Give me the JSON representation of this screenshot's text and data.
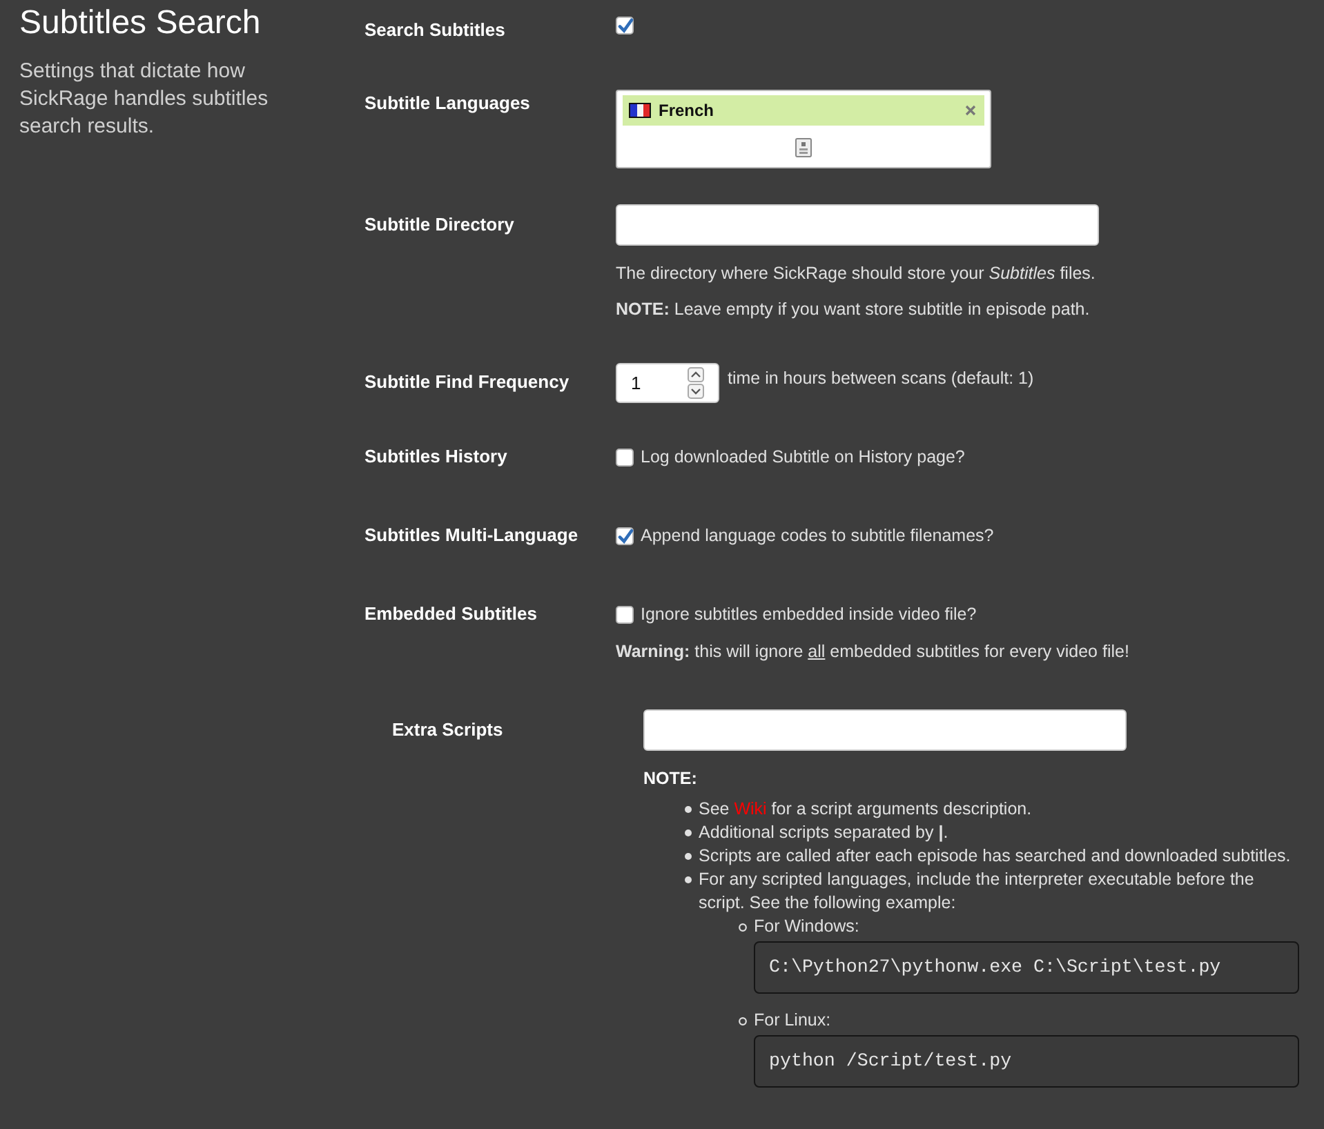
{
  "section": {
    "title": "Subtitles Search",
    "description": "Settings that dictate how SickRage handles subtitles search results."
  },
  "fields": [
    {
      "kind": "checkbox",
      "label": "Search Subtitles",
      "checked": true
    },
    {
      "kind": "tokens",
      "label": "Subtitle Languages",
      "tokens": [
        {
          "text": "French"
        }
      ]
    },
    {
      "kind": "text",
      "label": "Subtitle Directory",
      "help": [
        "The directory where SickRage should store your *Subtitles* files.",
        "**NOTE:** Leave empty if you want store subtitle in episode path."
      ]
    },
    {
      "kind": "number",
      "label": "Subtitle Find Frequency",
      "value": "1",
      "hint": "time in hours between scans (default: 1)"
    },
    {
      "kind": "checkbox",
      "label": "Subtitles History",
      "checked": false,
      "text": "Log downloaded Subtitle on History page?"
    },
    {
      "kind": "checkbox",
      "label": "Subtitles Multi-Language",
      "checked": true,
      "text": "Append language codes to subtitle filenames?"
    },
    {
      "kind": "checkbox",
      "label": "Embedded Subtitles",
      "checked": false,
      "text": "Ignore subtitles embedded inside video file?",
      "warning": [
        {
          "kind": "bold",
          "text": "Warning:"
        },
        {
          "kind": "plain",
          "text": " this will ignore "
        },
        {
          "kind": "underline",
          "text": "all"
        },
        {
          "kind": "plain",
          "text": " embedded subtitles for every video file!"
        }
      ]
    }
  ],
  "extra_scripts": {
    "label": "Extra Scripts",
    "note_title": "NOTE:",
    "notes": [
      {
        "parts": [
          {
            "kind": "text",
            "text": "See "
          },
          {
            "kind": "link",
            "text": "Wiki"
          },
          {
            "kind": "text",
            "text": " for a script arguments description."
          }
        ]
      },
      {
        "parts": [
          {
            "kind": "text",
            "text": "Additional scripts separated by **|**."
          }
        ]
      },
      {
        "parts": [
          {
            "kind": "text",
            "text": "Scripts are called after each episode has searched and downloaded subtitles."
          }
        ]
      },
      {
        "parts": [
          {
            "kind": "text",
            "text": "For any scripted languages, include the interpreter executable before the script. See the following example:"
          }
        ],
        "children": [
          {
            "text": "For Windows:",
            "code": "C:\\Python27\\pythonw.exe C:\\Script\\test.py"
          },
          {
            "text": "For Linux:",
            "code": "python /Script/test.py"
          }
        ]
      }
    ]
  }
}
